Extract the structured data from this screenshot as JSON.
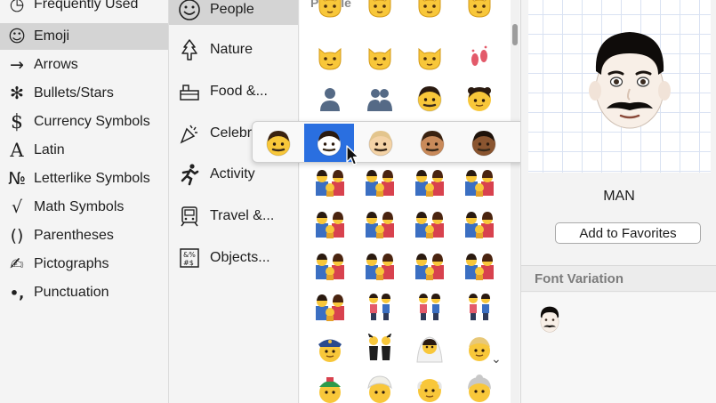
{
  "categories": [
    {
      "label": "Frequently Used",
      "icon": "clock-icon",
      "glyph": "◷",
      "selected": false
    },
    {
      "label": "Emoji",
      "icon": "smiley-icon",
      "glyph": "☺",
      "selected": true
    },
    {
      "label": "Arrows",
      "icon": "arrow-icon",
      "glyph": "→",
      "selected": false
    },
    {
      "label": "Bullets/Stars",
      "icon": "asterisk-icon",
      "glyph": "✻",
      "selected": false
    },
    {
      "label": "Currency Symbols",
      "icon": "dollar-icon",
      "glyph": "$",
      "selected": false
    },
    {
      "label": "Latin",
      "icon": "latin-a-icon",
      "glyph": "A",
      "selected": false
    },
    {
      "label": "Letterlike Symbols",
      "icon": "numero-icon",
      "glyph": "№",
      "selected": false
    },
    {
      "label": "Math Symbols",
      "icon": "square-root-icon",
      "glyph": "√",
      "selected": false
    },
    {
      "label": "Parentheses",
      "icon": "parentheses-icon",
      "glyph": "()",
      "selected": false
    },
    {
      "label": "Pictographs",
      "icon": "pen-icon",
      "glyph": "✍",
      "selected": false
    },
    {
      "label": "Punctuation",
      "icon": "punctuation-icon",
      "glyph": "•,",
      "selected": false
    }
  ],
  "subcategories": [
    {
      "label": "People",
      "icon": "smiley-icon",
      "selected": true
    },
    {
      "label": "Nature",
      "icon": "tree-icon",
      "selected": false
    },
    {
      "label": "Food &...",
      "icon": "food-icon",
      "selected": false
    },
    {
      "label": "Celebr",
      "icon": "party-popper-icon",
      "selected": false
    },
    {
      "label": "Activity",
      "icon": "runner-icon",
      "selected": false
    },
    {
      "label": "Travel &...",
      "icon": "train-icon",
      "selected": false
    },
    {
      "label": "Objects...",
      "icon": "objects-icon",
      "selected": false
    }
  ],
  "grid": {
    "header": "People",
    "rows": [
      [
        "cat-face",
        "cat-face",
        "cat-face",
        "cat-face"
      ],
      [
        "cat-face",
        "cat-face",
        "cat-face",
        "footprints"
      ],
      [
        "silhouette",
        "silhouettes",
        "boy",
        "girl"
      ],
      [
        "man",
        "",
        "",
        ""
      ],
      [
        "family",
        "family",
        "family",
        "family"
      ],
      [
        "family",
        "family",
        "family",
        "family"
      ],
      [
        "family",
        "family",
        "family",
        "family"
      ],
      [
        "family",
        "couple",
        "couple",
        "couple"
      ],
      [
        "police-officer",
        "dancers",
        "bride",
        "man-turban"
      ],
      [
        "man-cap",
        "turban",
        "older-man",
        "older-woman"
      ]
    ]
  },
  "skin_tones": [
    {
      "name": "default-tone",
      "face": "#f8c73a",
      "hair": "#3a2210",
      "selected": false
    },
    {
      "name": "light-tone",
      "face": "#ffffff",
      "hair": "#2a1a10",
      "selected": true
    },
    {
      "name": "medium-light-tone",
      "face": "#f4d3a6",
      "hair": "#e3c58d",
      "selected": false
    },
    {
      "name": "medium-tone",
      "face": "#c98a5a",
      "hair": "#3a2210",
      "selected": false
    },
    {
      "name": "medium-dark-tone",
      "face": "#8a5530",
      "hair": "#1e120a",
      "selected": false
    },
    {
      "name": "dark-tone",
      "face": "#4a2c1a",
      "hair": "#130c08",
      "selected": false
    }
  ],
  "preview": {
    "name": "MAN",
    "add_favorites": "Add to Favorites",
    "font_variation_header": "Font Variation"
  },
  "colors": {
    "selection_blue": "#2a6fe0",
    "emoji_yellow": "#f8c73a",
    "sidebar_selected": "#d4d4d4"
  }
}
